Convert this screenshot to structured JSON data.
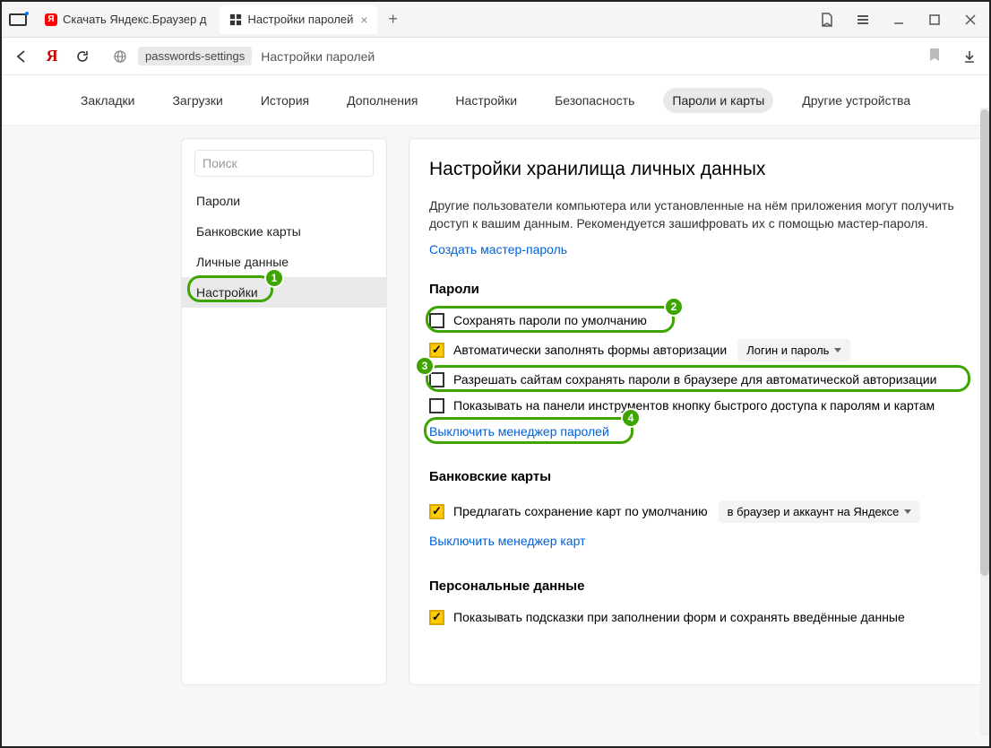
{
  "window": {
    "tabs": [
      {
        "title": "Скачать Яндекс.Браузер д"
      },
      {
        "title": "Настройки паролей"
      }
    ]
  },
  "address": {
    "chip": "passwords-settings",
    "title": "Настройки паролей"
  },
  "topnav": {
    "items": [
      "Закладки",
      "Загрузки",
      "История",
      "Дополнения",
      "Настройки",
      "Безопасность",
      "Пароли и карты",
      "Другие устройства"
    ],
    "activeIndex": 6
  },
  "sidebar": {
    "search_placeholder": "Поиск",
    "items": [
      "Пароли",
      "Банковские карты",
      "Личные данные",
      "Настройки"
    ],
    "activeIndex": 3
  },
  "main": {
    "heading": "Настройки хранилища личных данных",
    "description": "Другие пользователи компьютера или установленные на нём приложения могут получить доступ к вашим данным. Рекомендуется зашифровать их с помощью мастер-пароля.",
    "create_master_link": "Создать мастер-пароль",
    "sections": {
      "passwords": {
        "title": "Пароли",
        "opt_save_default": "Сохранять пароли по умолчанию",
        "opt_autofill": "Автоматически заполнять формы авторизации",
        "autofill_select": "Логин и пароль",
        "opt_allow_sites": "Разрешать сайтам сохранять пароли в браузере для автоматической авторизации",
        "opt_show_toolbar": "Показывать на панели инструментов кнопку быстрого доступа к паролям и картам",
        "disable_link": "Выключить менеджер паролей"
      },
      "cards": {
        "title": "Банковские карты",
        "opt_offer_save": "Предлагать сохранение карт по умолчанию",
        "save_select": "в браузер и аккаунт на Яндексе",
        "disable_link": "Выключить менеджер карт"
      },
      "personal": {
        "title": "Персональные данные",
        "opt_show_hints": "Показывать подсказки при заполнении форм и сохранять введённые данные"
      }
    }
  },
  "annotations": {
    "b1": "1",
    "b2": "2",
    "b3": "3",
    "b4": "4"
  }
}
